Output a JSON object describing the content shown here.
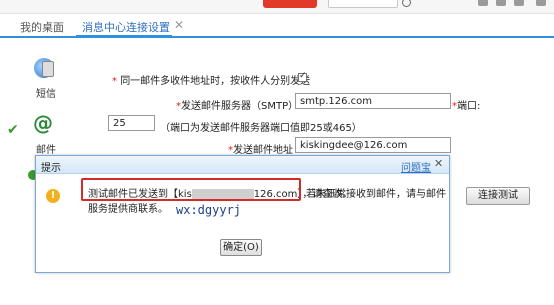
{
  "tabs": [
    {
      "label": "我的桌面"
    },
    {
      "label": "消息中心连接设置"
    }
  ],
  "tab_close": "✕",
  "nav": {
    "sms_label": "短信",
    "mail_label": "邮件"
  },
  "form": {
    "multi_recipient_label": "同一邮件多收件地址时，按收件人分别发送",
    "multi_recipient_checked": true,
    "smtp_label": "发送邮件服务器（SMTP）",
    "smtp_value": "smtp.126.com",
    "port_label": "端口:",
    "port_value": "25",
    "port_hint": "（端口为发送邮件服务器端口值即25或465）",
    "sender_label": "发送邮件地址",
    "sender_value": "kiskingdee@126.com",
    "test_button": "连接测试"
  },
  "dialog": {
    "title": "提示",
    "help_link": "问题宝",
    "close": "✕",
    "message_prefix": "测试邮件已发送到【kis",
    "message_suffix": "126.com】，请查收。",
    "message_tail": "若未正常接收到邮件，请与邮件",
    "message_line2": "服务提供商联系。",
    "watermark": "wx:dgyyrj",
    "ok_button": "确定(O)"
  }
}
